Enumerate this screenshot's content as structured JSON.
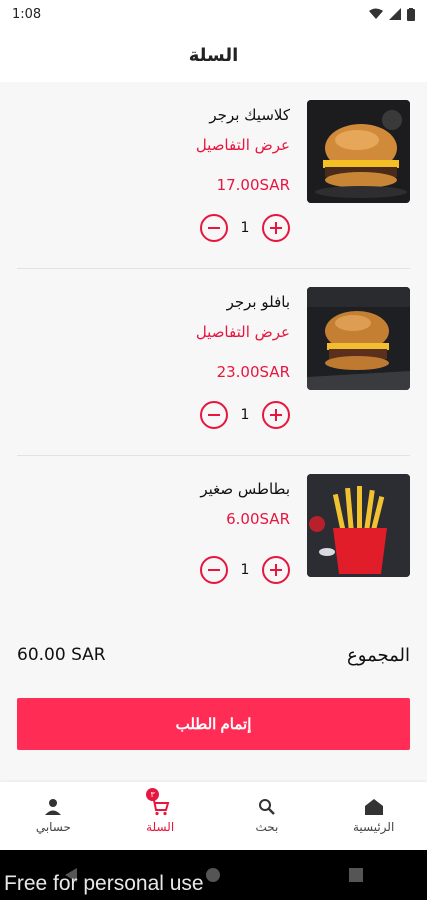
{
  "status_bar": {
    "time": "1:08"
  },
  "header": {
    "title": "السلة"
  },
  "cart": {
    "details_label": "عرض التفاصيل",
    "items": [
      {
        "name": "كلاسيك برجر",
        "price": "17.00SAR",
        "quantity": "1"
      },
      {
        "name": "بافلو برجر",
        "price": "23.00SAR",
        "quantity": "1"
      },
      {
        "name": "بطاطس صغير",
        "price": "6.00SAR",
        "quantity": "1"
      }
    ]
  },
  "summary": {
    "total_label": "المجموع",
    "total_value": "60.00 SAR"
  },
  "checkout": {
    "label": "إتمام الطلب"
  },
  "bottom_nav": {
    "items": [
      {
        "label": "حسابي",
        "icon": "person-icon"
      },
      {
        "label": "السلة",
        "icon": "cart-icon",
        "badge": "٣"
      },
      {
        "label": "بحث",
        "icon": "search-icon"
      },
      {
        "label": "الرئيسية",
        "icon": "home-icon"
      }
    ]
  },
  "watermark": {
    "text": "Free for personal use"
  },
  "colors": {
    "accent": "#e8163f",
    "button": "#ff2d55"
  }
}
